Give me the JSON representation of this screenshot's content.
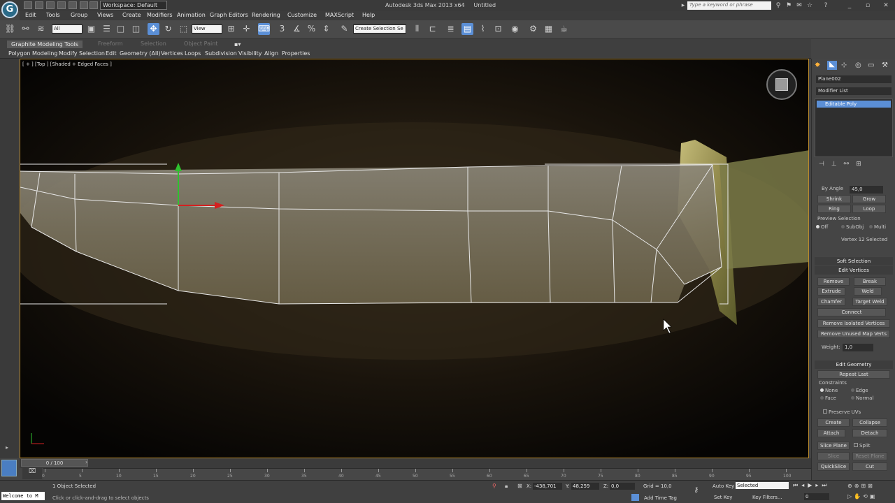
{
  "app": {
    "title": "Autodesk 3ds Max 2013 x64",
    "document": "Untitled",
    "workspace": "Workspace: Default",
    "search_placeholder": "Type a keyword or phrase"
  },
  "menu": [
    "Edit",
    "Tools",
    "Group",
    "Views",
    "Create",
    "Modifiers",
    "Animation",
    "Graph Editors",
    "Rendering",
    "Customize",
    "MAXScript",
    "Help"
  ],
  "toolbar": {
    "selection_filter": "All",
    "ref_coord": "View",
    "named_selection": "Create Selection Se"
  },
  "ribbon": {
    "tabs": [
      "Graphite Modeling Tools",
      "Freeform",
      "Selection",
      "Object Paint"
    ],
    "items": [
      "Polygon Modeling",
      "Modify Selection",
      "Edit",
      "Geometry (All)",
      "Vertices",
      "Loops",
      "Subdivision",
      "Visibility",
      "Align",
      "Properties"
    ]
  },
  "viewport": {
    "label": "[ + ] [Top ] [Shaded + Edged Faces ]"
  },
  "command_panel": {
    "object_name": "Plane002",
    "modifier_list": "Modifier List",
    "stack_item": "Editable Poly",
    "by_angle": "By Angle",
    "by_angle_value": "45,0",
    "shrink": "Shrink",
    "grow": "Grow",
    "ring": "Ring",
    "loop": "Loop",
    "preview_selection": "Preview Selection",
    "preview_off": "Off",
    "preview_subobj": "SubObj",
    "preview_multi": "Multi",
    "selection_status": "Vertex 12 Selected",
    "soft_selection": "Soft Selection",
    "edit_vertices": "Edit Vertices",
    "remove": "Remove",
    "break": "Break",
    "extrude": "Extrude",
    "weld": "Weld",
    "chamfer": "Chamfer",
    "target_weld": "Target Weld",
    "connect": "Connect",
    "remove_isolated": "Remove Isolated Vertices",
    "remove_unused": "Remove Unused Map Verts",
    "weight_label": "Weight:",
    "weight_value": "1,0",
    "edit_geometry": "Edit Geometry",
    "repeat_last": "Repeat Last",
    "constraints": "Constraints",
    "c_none": "None",
    "c_edge": "Edge",
    "c_face": "Face",
    "c_normal": "Normal",
    "preserve_uvs": "Preserve UVs",
    "create": "Create",
    "collapse": "Collapse",
    "attach": "Attach",
    "detach": "Detach",
    "slice_plane": "Slice Plane",
    "split": "Split",
    "slice": "Slice",
    "reset_plane": "Reset Plane",
    "quickslice": "QuickSlice",
    "cut": "Cut"
  },
  "timeline": {
    "frame_label": "0 / 100",
    "ticks": [
      "0",
      "5",
      "10",
      "15",
      "20",
      "25",
      "30",
      "35",
      "40",
      "45",
      "50",
      "55",
      "60",
      "65",
      "70",
      "75",
      "80",
      "85",
      "90",
      "95",
      "100"
    ]
  },
  "status": {
    "selection": "1 Object Selected",
    "prompt": "Click or click-and-drag to select objects",
    "x_label": "X:",
    "x_value": "-438,701",
    "y_label": "Y:",
    "y_value": "48,259",
    "z_label": "Z:",
    "z_value": "0,0",
    "grid": "Grid = 10,0",
    "auto_key": "Auto Key",
    "set_key": "Set Key",
    "selected_dropdown": "Selected",
    "key_filters": "Key Filters...",
    "add_time_tag": "Add Time Tag",
    "maxscript_listener": "Welcome to M",
    "frame_field": "0"
  }
}
